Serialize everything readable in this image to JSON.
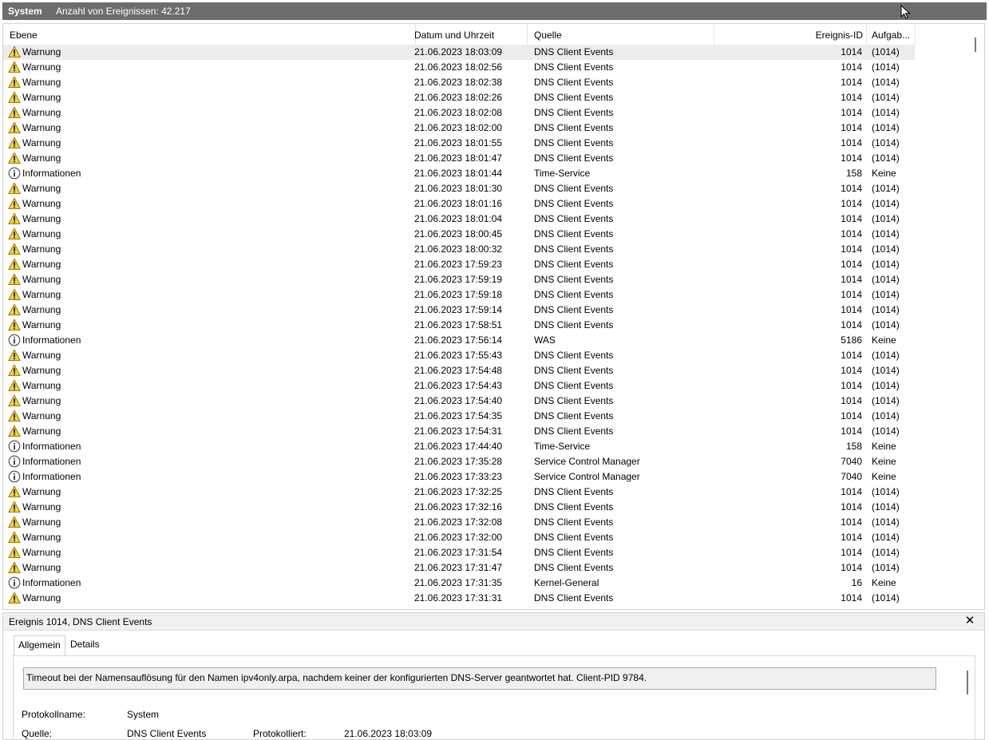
{
  "window": {
    "log_name": "System",
    "event_count": "Anzahl von Ereignissen: 42.217"
  },
  "columns": {
    "level": "Ebene",
    "date": "Datum und Uhrzeit",
    "source": "Quelle",
    "event_id": "Ereignis-ID",
    "task": "Aufgab..."
  },
  "events": [
    {
      "level": "Warnung",
      "type": "warning",
      "date": "21.06.2023 18:03:09",
      "source": "DNS Client Events",
      "id": "1014",
      "task": "(1014)"
    },
    {
      "level": "Warnung",
      "type": "warning",
      "date": "21.06.2023 18:02:56",
      "source": "DNS Client Events",
      "id": "1014",
      "task": "(1014)"
    },
    {
      "level": "Warnung",
      "type": "warning",
      "date": "21.06.2023 18:02:38",
      "source": "DNS Client Events",
      "id": "1014",
      "task": "(1014)"
    },
    {
      "level": "Warnung",
      "type": "warning",
      "date": "21.06.2023 18:02:26",
      "source": "DNS Client Events",
      "id": "1014",
      "task": "(1014)"
    },
    {
      "level": "Warnung",
      "type": "warning",
      "date": "21.06.2023 18:02:08",
      "source": "DNS Client Events",
      "id": "1014",
      "task": "(1014)"
    },
    {
      "level": "Warnung",
      "type": "warning",
      "date": "21.06.2023 18:02:00",
      "source": "DNS Client Events",
      "id": "1014",
      "task": "(1014)"
    },
    {
      "level": "Warnung",
      "type": "warning",
      "date": "21.06.2023 18:01:55",
      "source": "DNS Client Events",
      "id": "1014",
      "task": "(1014)"
    },
    {
      "level": "Warnung",
      "type": "warning",
      "date": "21.06.2023 18:01:47",
      "source": "DNS Client Events",
      "id": "1014",
      "task": "(1014)"
    },
    {
      "level": "Informationen",
      "type": "info",
      "date": "21.06.2023 18:01:44",
      "source": "Time-Service",
      "id": "158",
      "task": "Keine"
    },
    {
      "level": "Warnung",
      "type": "warning",
      "date": "21.06.2023 18:01:30",
      "source": "DNS Client Events",
      "id": "1014",
      "task": "(1014)"
    },
    {
      "level": "Warnung",
      "type": "warning",
      "date": "21.06.2023 18:01:16",
      "source": "DNS Client Events",
      "id": "1014",
      "task": "(1014)"
    },
    {
      "level": "Warnung",
      "type": "warning",
      "date": "21.06.2023 18:01:04",
      "source": "DNS Client Events",
      "id": "1014",
      "task": "(1014)"
    },
    {
      "level": "Warnung",
      "type": "warning",
      "date": "21.06.2023 18:00:45",
      "source": "DNS Client Events",
      "id": "1014",
      "task": "(1014)"
    },
    {
      "level": "Warnung",
      "type": "warning",
      "date": "21.06.2023 18:00:32",
      "source": "DNS Client Events",
      "id": "1014",
      "task": "(1014)"
    },
    {
      "level": "Warnung",
      "type": "warning",
      "date": "21.06.2023 17:59:23",
      "source": "DNS Client Events",
      "id": "1014",
      "task": "(1014)"
    },
    {
      "level": "Warnung",
      "type": "warning",
      "date": "21.06.2023 17:59:19",
      "source": "DNS Client Events",
      "id": "1014",
      "task": "(1014)"
    },
    {
      "level": "Warnung",
      "type": "warning",
      "date": "21.06.2023 17:59:18",
      "source": "DNS Client Events",
      "id": "1014",
      "task": "(1014)"
    },
    {
      "level": "Warnung",
      "type": "warning",
      "date": "21.06.2023 17:59:14",
      "source": "DNS Client Events",
      "id": "1014",
      "task": "(1014)"
    },
    {
      "level": "Warnung",
      "type": "warning",
      "date": "21.06.2023 17:58:51",
      "source": "DNS Client Events",
      "id": "1014",
      "task": "(1014)"
    },
    {
      "level": "Informationen",
      "type": "info",
      "date": "21.06.2023 17:56:14",
      "source": "WAS",
      "id": "5186",
      "task": "Keine"
    },
    {
      "level": "Warnung",
      "type": "warning",
      "date": "21.06.2023 17:55:43",
      "source": "DNS Client Events",
      "id": "1014",
      "task": "(1014)"
    },
    {
      "level": "Warnung",
      "type": "warning",
      "date": "21.06.2023 17:54:48",
      "source": "DNS Client Events",
      "id": "1014",
      "task": "(1014)"
    },
    {
      "level": "Warnung",
      "type": "warning",
      "date": "21.06.2023 17:54:43",
      "source": "DNS Client Events",
      "id": "1014",
      "task": "(1014)"
    },
    {
      "level": "Warnung",
      "type": "warning",
      "date": "21.06.2023 17:54:40",
      "source": "DNS Client Events",
      "id": "1014",
      "task": "(1014)"
    },
    {
      "level": "Warnung",
      "type": "warning",
      "date": "21.06.2023 17:54:35",
      "source": "DNS Client Events",
      "id": "1014",
      "task": "(1014)"
    },
    {
      "level": "Warnung",
      "type": "warning",
      "date": "21.06.2023 17:54:31",
      "source": "DNS Client Events",
      "id": "1014",
      "task": "(1014)"
    },
    {
      "level": "Informationen",
      "type": "info",
      "date": "21.06.2023 17:44:40",
      "source": "Time-Service",
      "id": "158",
      "task": "Keine"
    },
    {
      "level": "Informationen",
      "type": "info",
      "date": "21.06.2023 17:35:28",
      "source": "Service Control Manager",
      "id": "7040",
      "task": "Keine"
    },
    {
      "level": "Informationen",
      "type": "info",
      "date": "21.06.2023 17:33:23",
      "source": "Service Control Manager",
      "id": "7040",
      "task": "Keine"
    },
    {
      "level": "Warnung",
      "type": "warning",
      "date": "21.06.2023 17:32:25",
      "source": "DNS Client Events",
      "id": "1014",
      "task": "(1014)"
    },
    {
      "level": "Warnung",
      "type": "warning",
      "date": "21.06.2023 17:32:16",
      "source": "DNS Client Events",
      "id": "1014",
      "task": "(1014)"
    },
    {
      "level": "Warnung",
      "type": "warning",
      "date": "21.06.2023 17:32:08",
      "source": "DNS Client Events",
      "id": "1014",
      "task": "(1014)"
    },
    {
      "level": "Warnung",
      "type": "warning",
      "date": "21.06.2023 17:32:00",
      "source": "DNS Client Events",
      "id": "1014",
      "task": "(1014)"
    },
    {
      "level": "Warnung",
      "type": "warning",
      "date": "21.06.2023 17:31:54",
      "source": "DNS Client Events",
      "id": "1014",
      "task": "(1014)"
    },
    {
      "level": "Warnung",
      "type": "warning",
      "date": "21.06.2023 17:31:47",
      "source": "DNS Client Events",
      "id": "1014",
      "task": "(1014)"
    },
    {
      "level": "Informationen",
      "type": "info",
      "date": "21.06.2023 17:31:35",
      "source": "Kernel-General",
      "id": "16",
      "task": "Keine"
    },
    {
      "level": "Warnung",
      "type": "warning",
      "date": "21.06.2023 17:31:31",
      "source": "DNS Client Events",
      "id": "1014",
      "task": "(1014)"
    }
  ],
  "selected_index": 0,
  "icons": {
    "warning": "warning-triangle-icon",
    "info": "info-circle-icon",
    "close": "close-icon"
  },
  "colors": {
    "warning_fill": "#f5d33d",
    "info_stroke": "#4a4a4a",
    "titlebar": "#6d6d6d"
  },
  "detail": {
    "title": "Ereignis 1014, DNS Client Events",
    "close": "✕",
    "tabs": [
      "Allgemein",
      "Details"
    ],
    "active_tab": "Allgemein",
    "message": "Timeout bei der Namensauflösung für den Namen ipv4only.arpa, nachdem keiner der konfigurierten DNS-Server geantwortet hat. Client-PID 9784.",
    "fields": {
      "log_name_label": "Protokollname:",
      "log_name_value": "System",
      "source_label": "Quelle:",
      "source_value": "DNS Client Events",
      "logged_label": "Protokolliert:",
      "logged_value": "21.06.2023 18:03:09"
    }
  }
}
